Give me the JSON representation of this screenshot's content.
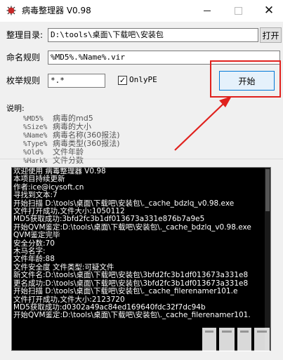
{
  "window": {
    "title": "病毒整理器 V0.98",
    "close_glyph": "✕"
  },
  "form": {
    "dir_label": "整理目录:",
    "dir_value": "D:\\tools\\桌面\\下载吧\\安装包",
    "open_button": "打开",
    "name_rule_label": "命名规则",
    "name_rule_value": "%MD5%.%Name%.vir",
    "enum_rule_label": "枚举规则",
    "enum_rule_value": "*.*",
    "onlype_label": "OnlyPE",
    "onlype_checked": true,
    "check_glyph": "✓",
    "start_button": "开始"
  },
  "notes": {
    "heading": "说明:",
    "items": [
      {
        "key": "%MD5%",
        "desc": "病毒的md5"
      },
      {
        "key": "%Size%",
        "desc": "病毒的大小"
      },
      {
        "key": "%Name%",
        "desc": "病毒名称(360报法)"
      },
      {
        "key": "%Type%",
        "desc": "病毒类型(360报法)"
      },
      {
        "key": "%Old%",
        "desc": "文件年龄"
      },
      {
        "key": "%Mark%",
        "desc": "文件分数"
      }
    ]
  },
  "console": {
    "lines": [
      {
        "text": "欢迎使用 病毒整理器 V0.98",
        "mono": false
      },
      {
        "text": "本项目持续更新",
        "mono": false
      },
      {
        "text": "作者:ice@icysoft.cn",
        "mono": false
      },
      {
        "text": "寻找到文本:7",
        "mono": false
      },
      {
        "text": "开始扫描 D:\\tools\\桌面\\下载吧\\安装包\\._cache_bdzlq_v0.98.exe",
        "mono": false
      },
      {
        "text": "文件打开成功,文件大小:1050112",
        "mono": false
      },
      {
        "text": "MD5获取成功:3bfd2fc3b1df013673a331e876b7a9e5",
        "mono": false
      },
      {
        "text": "开始QVM鉴定:D:\\tools\\桌面\\下载吧\\安装包\\._cache_bdzlq_v0.98.exe",
        "mono": false
      },
      {
        "text": "QVM鉴定完毕",
        "mono": false
      },
      {
        "text": "安全分数:70",
        "mono": false
      },
      {
        "text": "木马名字:",
        "mono": false
      },
      {
        "text": "文件年龄:88",
        "mono": false
      },
      {
        "text": "文件安全度 文件类型:可疑文件",
        "mono": false
      },
      {
        "text": "新文件名:D:\\tools\\桌面\\下载吧\\安装包\\3bfd2fc3b1df013673a331e8",
        "mono": false
      },
      {
        "text": "更名成功:D:\\tools\\桌面\\下载吧\\安装包\\3bfd2fc3b1df013673a331e8",
        "mono": false
      },
      {
        "text": "开始扫描 D:\\tools\\桌面\\下载吧\\安装包\\._cache_filerenamer101.e",
        "mono": false
      },
      {
        "text": "文件打开成功,文件大小:2123720",
        "mono": false
      },
      {
        "text": "MD5获取成功:d0302a49ac84ed169640fdc32f7dc94b",
        "mono": false
      },
      {
        "text": "开始QVM鉴定:D:\\tools\\桌面\\下载吧\\安装包\\._cache_filerenamer101.",
        "mono": false
      }
    ]
  },
  "colors": {
    "highlight": "#e0211d",
    "start_border": "#0078d7"
  }
}
